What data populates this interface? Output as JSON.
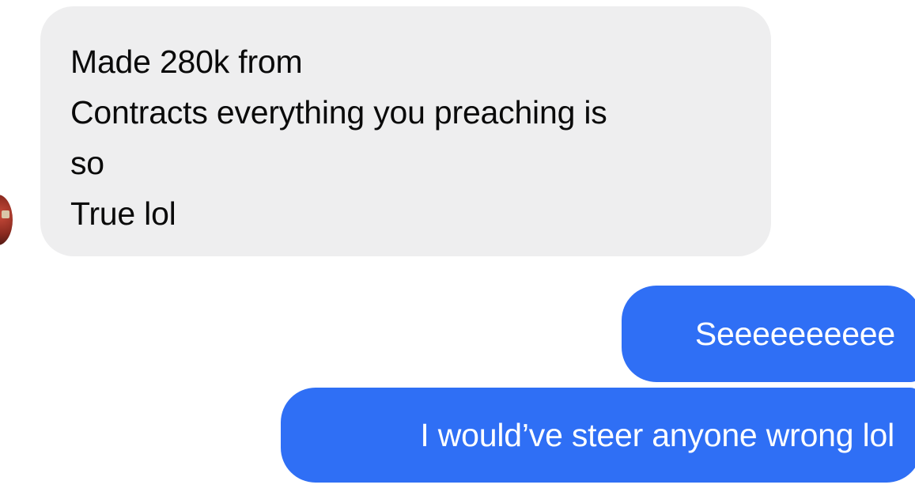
{
  "conversation": {
    "incoming": {
      "lines": [
        "Made 280k from",
        "Contracts everything you preaching is",
        "so",
        "True lol"
      ]
    },
    "outgoing": [
      {
        "text": "Seeeeeeeeee"
      },
      {
        "text": "I would’ve steer anyone wrong lol"
      }
    ]
  },
  "colors": {
    "incoming_bubble": "#eeeeef",
    "outgoing_bubble": "#2f6ff5",
    "incoming_text": "#0a0a0a",
    "outgoing_text": "#ffffff"
  }
}
